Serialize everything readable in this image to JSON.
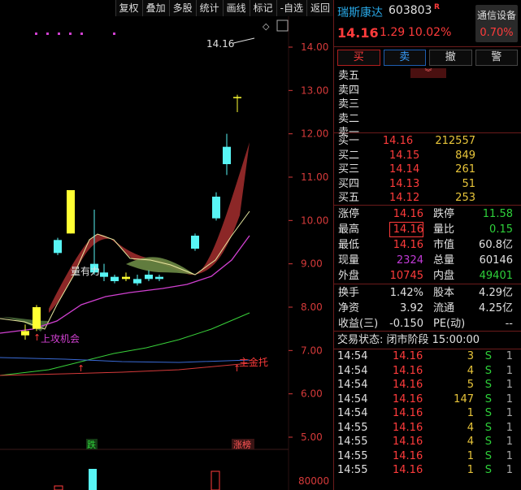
{
  "toolbar": [
    "复权",
    "叠加",
    "多股",
    "统计",
    "画线",
    "标记",
    "-自选",
    "返回"
  ],
  "chart_data": {
    "type": "candlestick",
    "y_ticks": [
      "14.00",
      "13.00",
      "12.00",
      "11.00",
      "10.00",
      "9.00",
      "8.00",
      "7.00",
      "6.00",
      "5.00"
    ],
    "y_values": [
      14,
      13,
      12,
      11,
      10,
      9,
      8,
      7,
      6,
      5
    ],
    "high_label": "14.16",
    "annotations": {
      "liangyouli": "量有力",
      "shanggong": "上攻机会",
      "zhujintuo": "主金托"
    },
    "markers": {
      "die": "跌",
      "zhangbang": "涨榜"
    },
    "vol_tick": "80000",
    "candles": [
      {
        "o": 7.35,
        "c": 7.45,
        "h": 7.6,
        "l": 7.25
      },
      {
        "o": 7.5,
        "c": 8.0,
        "h": 8.05,
        "l": 7.45
      },
      {
        "o": 9.55,
        "c": 9.25,
        "h": 9.6,
        "l": 9.2
      },
      {
        "o": 9.7,
        "c": 10.7,
        "h": 10.7,
        "l": 9.7
      },
      {
        "o": 9.0,
        "c": 8.8,
        "h": 10.25,
        "l": 8.75
      },
      {
        "o": 8.8,
        "c": 8.7,
        "h": 9.0,
        "l": 8.6
      },
      {
        "o": 8.7,
        "c": 8.6,
        "h": 8.75,
        "l": 8.55
      },
      {
        "o": 8.65,
        "c": 8.7,
        "h": 8.8,
        "l": 8.6
      },
      {
        "o": 8.65,
        "c": 8.55,
        "h": 8.75,
        "l": 8.5
      },
      {
        "o": 8.75,
        "c": 8.65,
        "h": 8.85,
        "l": 8.6
      },
      {
        "o": 8.7,
        "c": 8.65,
        "h": 8.75,
        "l": 8.6
      },
      {
        "o": 9.65,
        "c": 9.35,
        "h": 9.7,
        "l": 9.3
      },
      {
        "o": 10.55,
        "c": 10.05,
        "h": 10.65,
        "l": 10.0
      },
      {
        "o": 11.7,
        "c": 11.3,
        "h": 12.0,
        "l": 11.05
      },
      {
        "o": 12.85,
        "c": 12.85,
        "h": 12.9,
        "l": 12.5
      }
    ]
  },
  "stock": {
    "name": "瑞斯康达",
    "code": "603803",
    "badge": "R",
    "price": "14.16",
    "change": "1.29",
    "change_pct": "10.02%",
    "sector": "通信设备",
    "sector_pct": "0.70%"
  },
  "buttons": {
    "buy": "买",
    "sell": "卖",
    "cancel": "撤",
    "alert": "警"
  },
  "asks": [
    "卖五",
    "卖四",
    "卖三",
    "卖二",
    "卖一"
  ],
  "bids": [
    {
      "label": "买一",
      "price": "14.16",
      "vol": "212557"
    },
    {
      "label": "买二",
      "price": "14.15",
      "vol": "849"
    },
    {
      "label": "买三",
      "price": "14.14",
      "vol": "261"
    },
    {
      "label": "买四",
      "price": "14.13",
      "vol": "51"
    },
    {
      "label": "买五",
      "price": "14.12",
      "vol": "253"
    }
  ],
  "stats": [
    {
      "l1": "涨停",
      "v1": "14.16",
      "l2": "跌停",
      "v2": "11.58"
    },
    {
      "l1": "最高",
      "v1": "14.16",
      "l2": "量比",
      "v2": "0.15"
    },
    {
      "l1": "最低",
      "v1": "14.16",
      "l2": "市值",
      "v2": "60.8亿"
    },
    {
      "l1": "现量",
      "v1": "2324",
      "l2": "总量",
      "v2": "60146"
    },
    {
      "l1": "外盘",
      "v1": "10745",
      "l2": "内盘",
      "v2": "49401"
    }
  ],
  "finance": [
    {
      "l1": "换手",
      "v1": "1.42%",
      "l2": "股本",
      "v2": "4.29亿"
    },
    {
      "l1": "净资",
      "v1": "3.92",
      "l2": "流通",
      "v2": "4.25亿"
    },
    {
      "l1": "收益(三)",
      "v1": "-0.150",
      "l2": "PE(动)",
      "v2": "--"
    }
  ],
  "status_line": "交易状态: 闭市阶段 15:00:00",
  "ticks": [
    {
      "t": "14:54",
      "p": "14.16",
      "q": "3",
      "d": "S",
      "n": "1"
    },
    {
      "t": "14:54",
      "p": "14.16",
      "q": "4",
      "d": "S",
      "n": "1"
    },
    {
      "t": "14:54",
      "p": "14.16",
      "q": "5",
      "d": "S",
      "n": "1"
    },
    {
      "t": "14:54",
      "p": "14.16",
      "q": "147",
      "d": "S",
      "n": "1"
    },
    {
      "t": "14:54",
      "p": "14.16",
      "q": "1",
      "d": "S",
      "n": "1"
    },
    {
      "t": "14:55",
      "p": "14.16",
      "q": "4",
      "d": "S",
      "n": "1"
    },
    {
      "t": "14:55",
      "p": "14.16",
      "q": "4",
      "d": "S",
      "n": "1"
    },
    {
      "t": "14:55",
      "p": "14.16",
      "q": "1",
      "d": "S",
      "n": "1"
    },
    {
      "t": "14:55",
      "p": "14.16",
      "q": "1",
      "d": "S",
      "n": "1"
    }
  ],
  "colors": {
    "up": "#ff3b3b",
    "down": "#2ed13a",
    "bull_fill": "#ffff33",
    "bear_fill": "#58f5f5",
    "accent": "#29a9e8"
  }
}
